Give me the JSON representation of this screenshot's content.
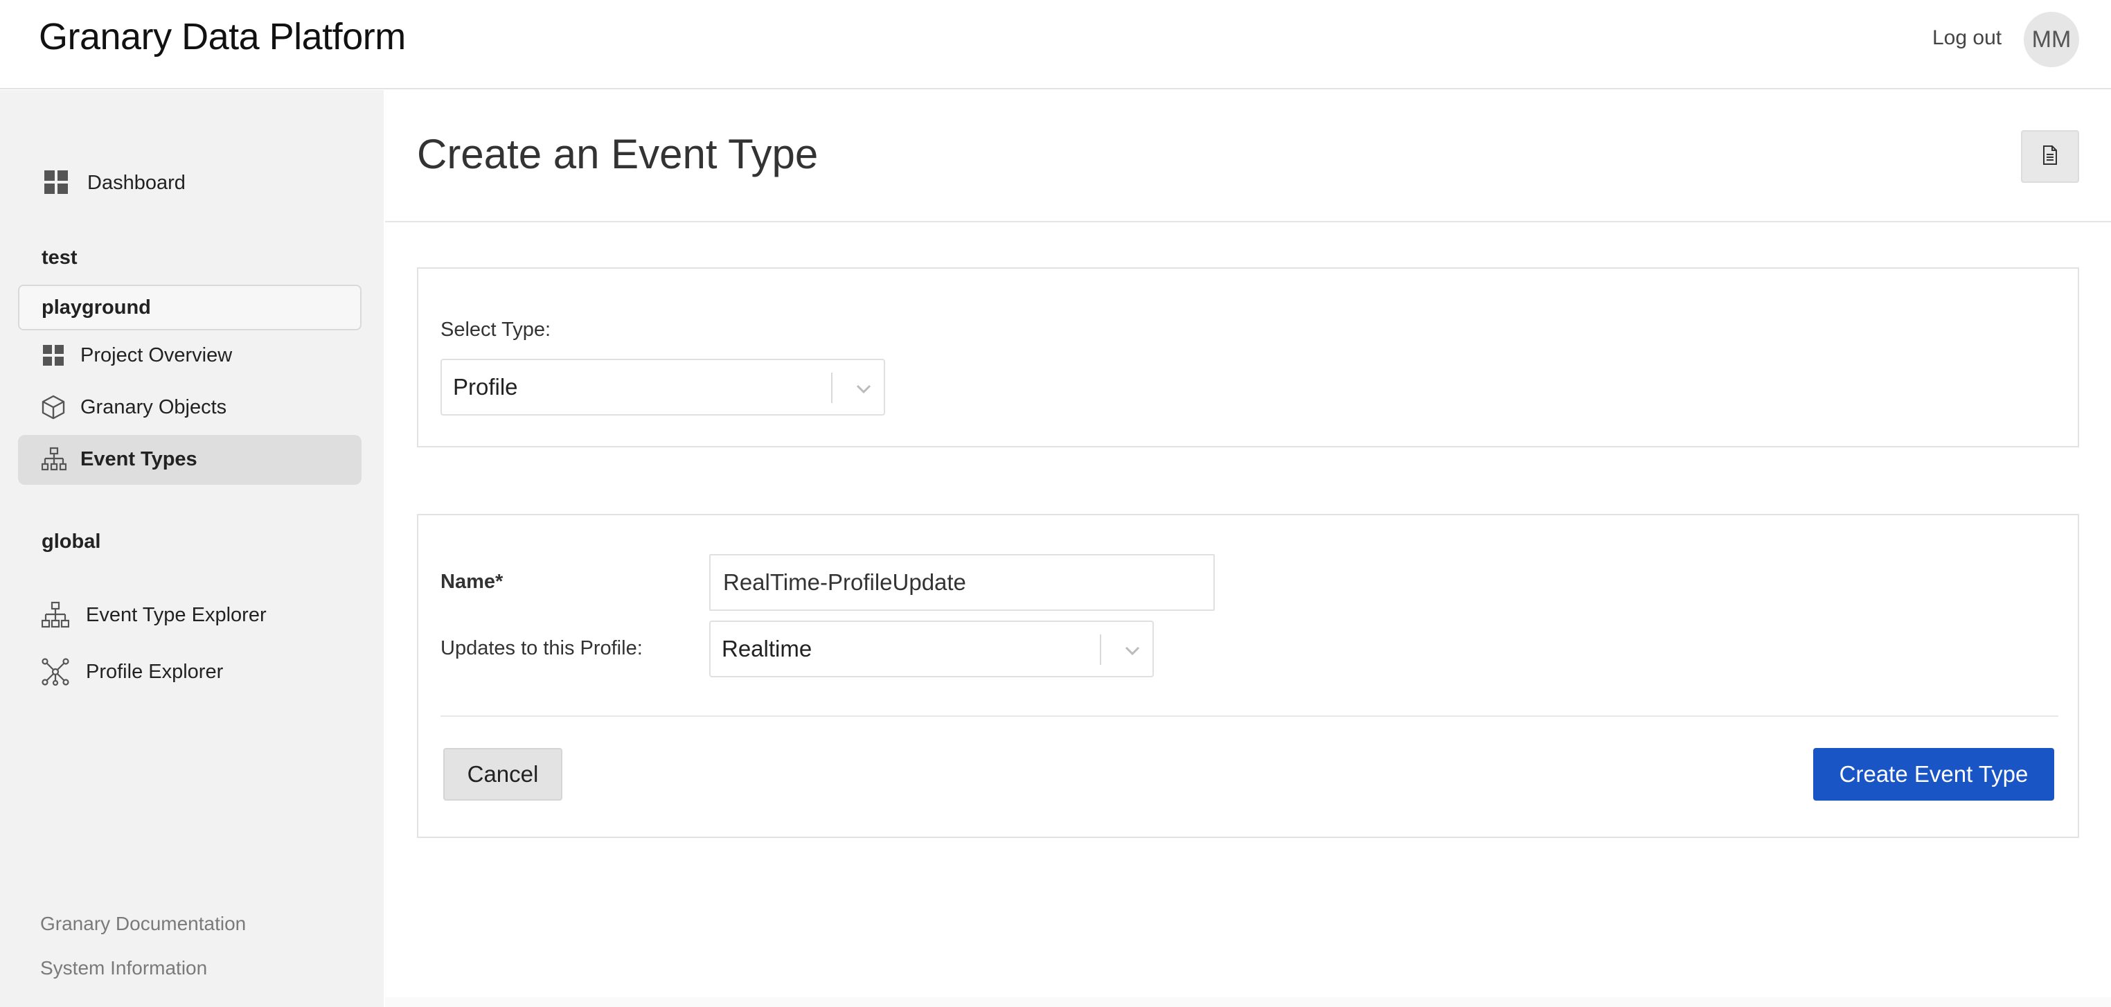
{
  "header": {
    "app_title": "Granary Data Platform",
    "logout_label": "Log out",
    "avatar_initials": "MM"
  },
  "sidebar": {
    "dashboard_label": "Dashboard",
    "section_test": "test",
    "project_name": "playground",
    "items": [
      {
        "label": "Project Overview",
        "icon": "grid-icon"
      },
      {
        "label": "Granary Objects",
        "icon": "cube-icon"
      },
      {
        "label": "Event Types",
        "icon": "hierarchy-icon",
        "active": true
      }
    ],
    "section_global": "global",
    "global_items": [
      {
        "label": "Event Type Explorer",
        "icon": "hierarchy-icon"
      },
      {
        "label": "Profile Explorer",
        "icon": "network-icon"
      }
    ],
    "footer_links": [
      "Granary Documentation",
      "System Information"
    ]
  },
  "page": {
    "title": "Create an Event Type",
    "doc_icon": "document-icon"
  },
  "type_panel": {
    "select_label": "Select Type:",
    "select_value": "Profile"
  },
  "form": {
    "name_label": "Name*",
    "name_value": "RealTime-ProfileUpdate",
    "updates_label": "Updates to this Profile:",
    "updates_value": "Realtime",
    "cancel_label": "Cancel",
    "create_label": "Create Event Type"
  },
  "colors": {
    "primary": "#1a55c6",
    "sidebar_bg": "#f2f2f2",
    "active_bg": "#dedede"
  }
}
